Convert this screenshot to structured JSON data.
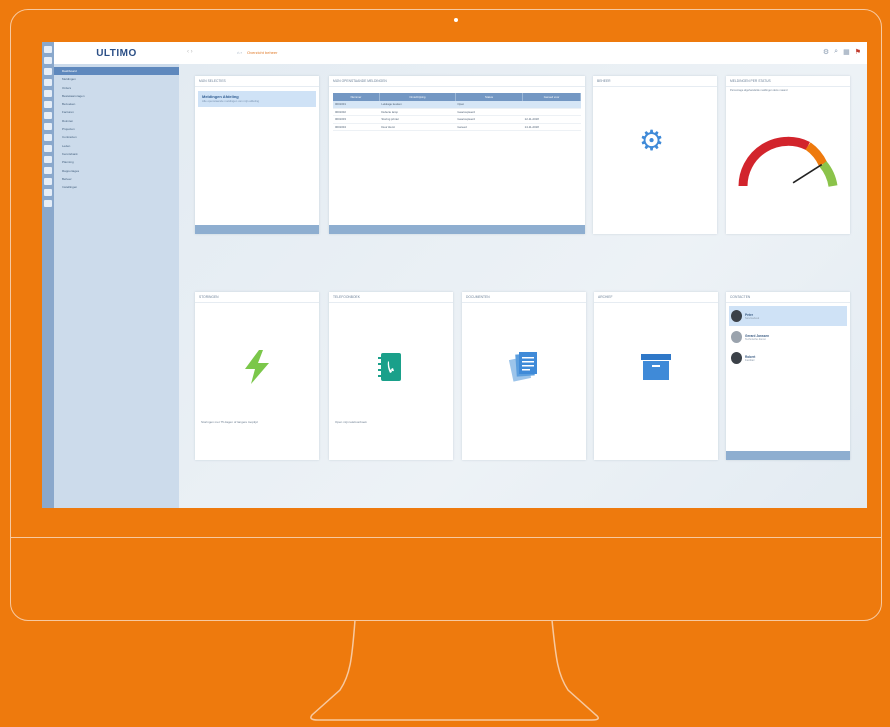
{
  "app": {
    "logo": "ULTIMO"
  },
  "topbar": {
    "nav_back": "‹ ›",
    "breadcrumb_home": "⌂ ›",
    "breadcrumb": "Overzicht beheer",
    "icons": [
      "gear-icon",
      "search-icon",
      "grid-icon",
      "flag-icon"
    ]
  },
  "sidebar": {
    "items": [
      {
        "label": "Dashboard",
        "active": true
      },
      {
        "label": "Meldingen",
        "active": false
      },
      {
        "label": "Orders",
        "active": false
      },
      {
        "label": "Bestelaanvragen",
        "active": false
      },
      {
        "label": "Bezoeken",
        "active": false
      },
      {
        "label": "Facturen",
        "active": false
      },
      {
        "label": "Ruimten",
        "active": false
      },
      {
        "label": "Projecten",
        "active": false
      },
      {
        "label": "Contracten",
        "active": false
      },
      {
        "label": "Leden",
        "active": false
      },
      {
        "label": "Kennisbank",
        "active": false
      },
      {
        "label": "Planning",
        "active": false
      },
      {
        "label": "Rapportages",
        "active": false
      },
      {
        "label": "Beheer",
        "active": false
      },
      {
        "label": "Instellingen",
        "active": false
      }
    ]
  },
  "widgets": {
    "w1": {
      "title": "MIJN SELECTIES",
      "item_title": "Meldingen Afdeling",
      "item_sub": "Alle openstaande meldingen van mijn afdeling"
    },
    "w2": {
      "title": "MIJN OPENSTAANDE MELDINGEN",
      "columns": [
        "Nummer",
        "Omschrijving",
        "Status",
        "Gereed voor"
      ],
      "rows": [
        [
          "0001001",
          "Lekkage keuken",
          "Open",
          ""
        ],
        [
          "0001002",
          "Defecte lamp",
          "Geaccepteerd",
          ""
        ],
        [
          "0001003",
          "Storing printer",
          "Geaccepteerd",
          "12-11-2018"
        ],
        [
          "0001004",
          "Deur klemt",
          "Gereed",
          "14-11-2018"
        ]
      ]
    },
    "w3": {
      "title": "BEHEER"
    },
    "w4": {
      "title": "MELDINGEN PER STATUS",
      "sub": "Percentage afgehandelde meldingen deze maand"
    },
    "w5": {
      "title": "STORINGEN",
      "desc": "Storingen met 75 dagen of langere looptijd"
    },
    "w6": {
      "title": "TELEFOONBOEK",
      "desc": "Open mijn telefoonboek"
    },
    "w7": {
      "title": "DOCUMENTEN"
    },
    "w8": {
      "title": "ARCHIEF"
    },
    "w9": {
      "title": "CONTACTEN",
      "contacts": [
        {
          "name": "Peter",
          "sub": "Servicedesk"
        },
        {
          "name": "Gerard Janssen",
          "sub": "Technische dienst"
        },
        {
          "name": "Robert",
          "sub": "Facilitair"
        }
      ]
    }
  },
  "colors": {
    "accent": "#ee7a0d",
    "nav_active": "#5e88bd",
    "sidebar_bg": "#ccdbeb",
    "icon_blue": "#3f8ad8",
    "icon_green": "#7bc74a"
  },
  "gauge": {
    "value": 0.82
  }
}
